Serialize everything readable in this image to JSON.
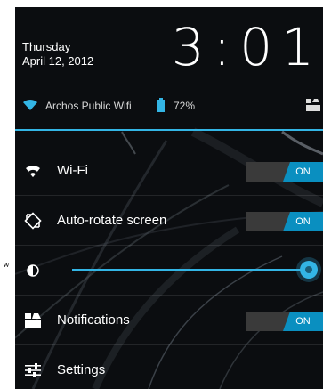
{
  "clock": {
    "day": "Thursday",
    "date": "April 12, 2012",
    "time": "3:01"
  },
  "status": {
    "network": "Archos Public Wifi",
    "battery": "72%",
    "icons": [
      "wifi-icon",
      "battery-icon",
      "notifications-icon"
    ]
  },
  "settings": {
    "wifi": {
      "label": "Wi-Fi",
      "state": "ON",
      "icon": "wifi-icon"
    },
    "autorotate": {
      "label": "Auto-rotate screen",
      "state": "ON",
      "icon": "rotate-icon"
    },
    "brightness": {
      "icon": "brightness-icon",
      "level": 1.0
    },
    "notifications": {
      "label": "Notifications",
      "state": "ON",
      "icon": "notifications-icon"
    },
    "settings": {
      "label": "Settings",
      "icon": "settings-sliders-icon"
    }
  },
  "outside_mark": "w",
  "colors": {
    "accent": "#33b5e5",
    "toggle_on": "#0a8fc0",
    "toggle_off": "#3a3a3a",
    "panel_bg": "#0b0d10"
  }
}
